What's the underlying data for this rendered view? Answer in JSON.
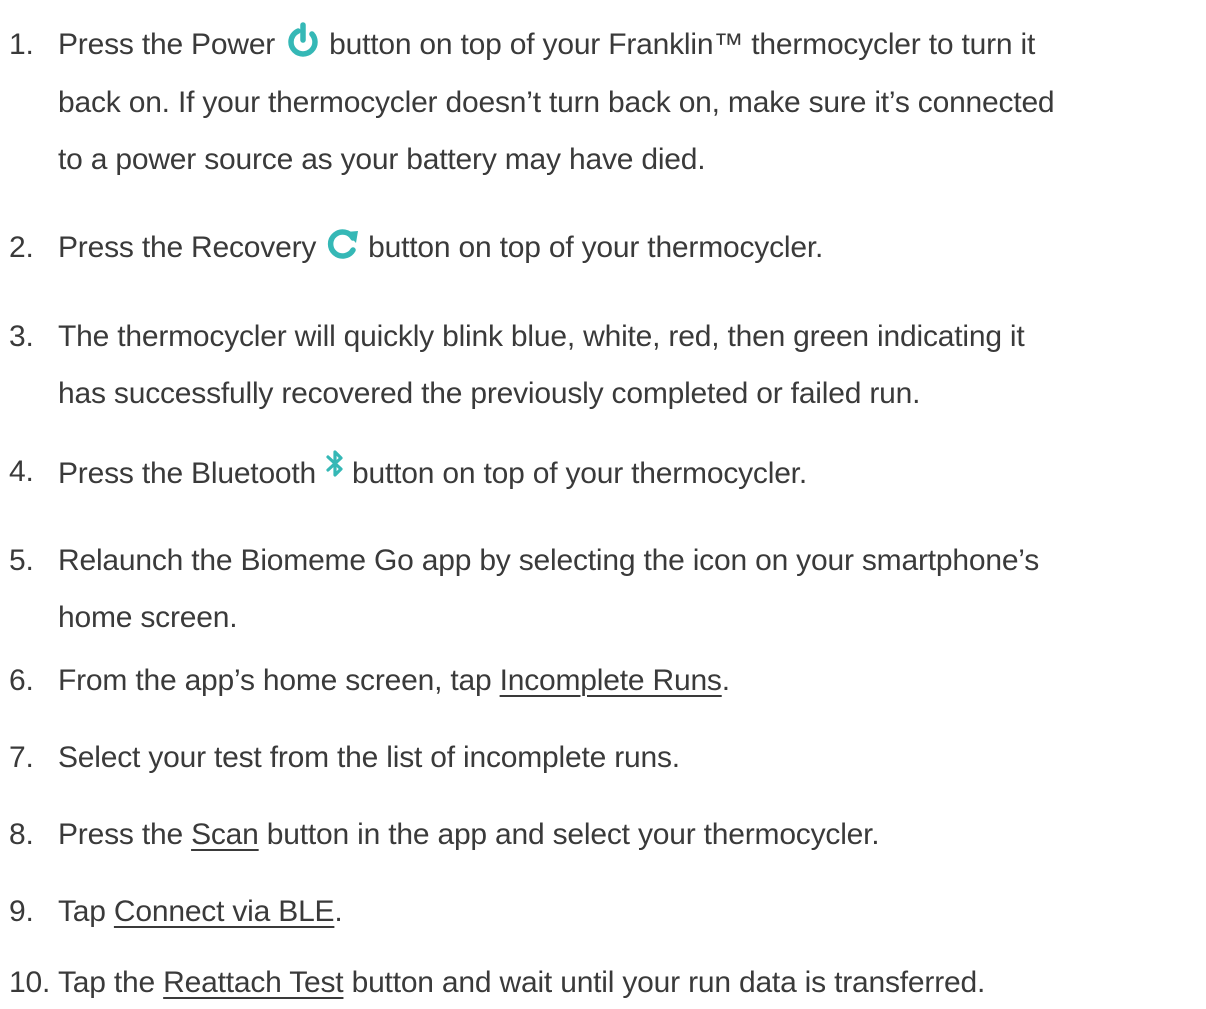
{
  "colors": {
    "text": "#3a3a3a",
    "icon_teal": "#35b8b6"
  },
  "steps": [
    {
      "number": "1.",
      "lines": [
        {
          "before": "Press the Power",
          "icon": "power-icon",
          "after": "button on top of your Franklin™ thermocycler to turn it"
        },
        {
          "text": "back on. If your thermocycler doesn’t turn back on, make sure it’s connected"
        },
        {
          "text": "to a power source as your battery may have died."
        }
      ]
    },
    {
      "number": "2.",
      "lines": [
        {
          "before": "Press the Recovery",
          "icon": "recovery-icon",
          "after": "button on top of your thermocycler."
        }
      ]
    },
    {
      "number": "3.",
      "lines": [
        {
          "text": "The thermocycler will quickly blink blue, white, red, then green indicating it"
        },
        {
          "text": "has successfully recovered the previously completed or failed run."
        }
      ]
    },
    {
      "number": "4.",
      "lines": [
        {
          "before": "Press the Bluetooth",
          "icon": "bluetooth-icon",
          "after": "button on top of your thermocycler."
        }
      ]
    },
    {
      "number": "5.",
      "lines": [
        {
          "text": "Relaunch the Biomeme Go app by selecting the icon on your smartphone’s"
        },
        {
          "text": "home screen."
        }
      ]
    },
    {
      "number": "6.",
      "lines": [
        {
          "before": "From the app’s home screen, tap ",
          "link": "Incomplete Runs",
          "after": "."
        }
      ]
    },
    {
      "number": "7.",
      "lines": [
        {
          "text": "Select your test from the list of incomplete runs."
        }
      ]
    },
    {
      "number": "8.",
      "lines": [
        {
          "before": "Press the ",
          "link": "Scan",
          "after": " button in the app and select your thermocycler."
        }
      ]
    },
    {
      "number": "9.",
      "lines": [
        {
          "before": "Tap ",
          "link": "Connect via BLE",
          "after": "."
        }
      ]
    },
    {
      "number": "10.",
      "lines": [
        {
          "before": "Tap the ",
          "link": "Reattach Test",
          "after": " button and wait until your run data is transferred."
        }
      ]
    }
  ]
}
